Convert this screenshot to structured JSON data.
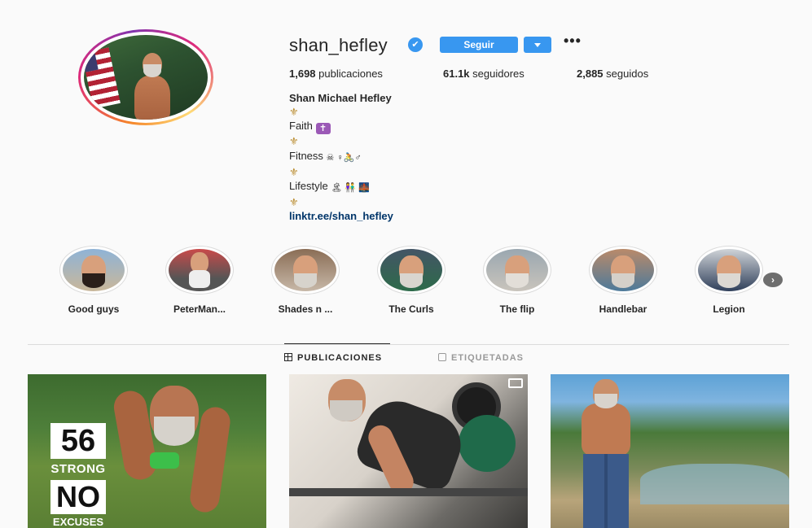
{
  "profile": {
    "username": "shan_hefley",
    "verified_icon": "✔",
    "follow_label": "Seguir",
    "more_label": "•••",
    "stats": {
      "posts_count": "1,698",
      "posts_label": " publicaciones",
      "followers_count": "61.1k",
      "followers_label": " seguidores",
      "following_count": "2,885",
      "following_label": " seguidos"
    },
    "bio": {
      "name": "Shan Michael Hefley",
      "fleur": "⚜",
      "faith": "Faith",
      "fitness": "Fitness",
      "lifestyle": "Lifestyle",
      "link": "linktr.ee/shan_hefley"
    }
  },
  "stories": [
    {
      "label": "Good guys"
    },
    {
      "label": "PeterMan..."
    },
    {
      "label": "Shades n ..."
    },
    {
      "label": "The Curls"
    },
    {
      "label": "The flip"
    },
    {
      "label": "Handlebar"
    },
    {
      "label": "Legion"
    }
  ],
  "next_arrow": "›",
  "tabs": {
    "posts": "PUBLICACIONES",
    "tagged": "ETIQUETADAS"
  },
  "posts": {
    "post1": {
      "line1": "56",
      "line2": "STRONG",
      "line3": "NO",
      "line4": "EXCUSES"
    }
  },
  "colors": {
    "accent": "#3897f0",
    "link": "#003569",
    "text": "#262626",
    "background": "#fafafa"
  }
}
